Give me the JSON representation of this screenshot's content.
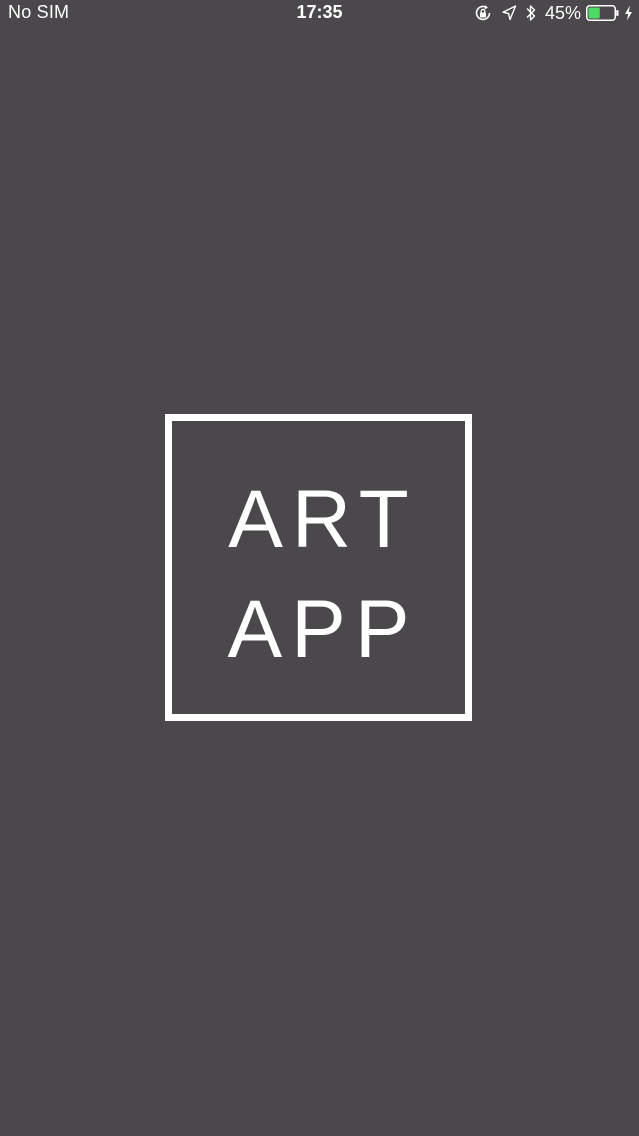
{
  "status_bar": {
    "carrier": "No SIM",
    "time": "17:35",
    "battery_percent": "45%",
    "battery_level": 0.45,
    "icons": [
      "orientation-lock-icon",
      "location-arrow-icon",
      "bluetooth-icon",
      "battery-icon",
      "charging-bolt-icon"
    ]
  },
  "splash": {
    "logo_line_1": "ART",
    "logo_line_2": "APP"
  },
  "colors": {
    "background": "#4a484b",
    "foreground": "#ffffff",
    "battery_fill": "#4cd964"
  }
}
